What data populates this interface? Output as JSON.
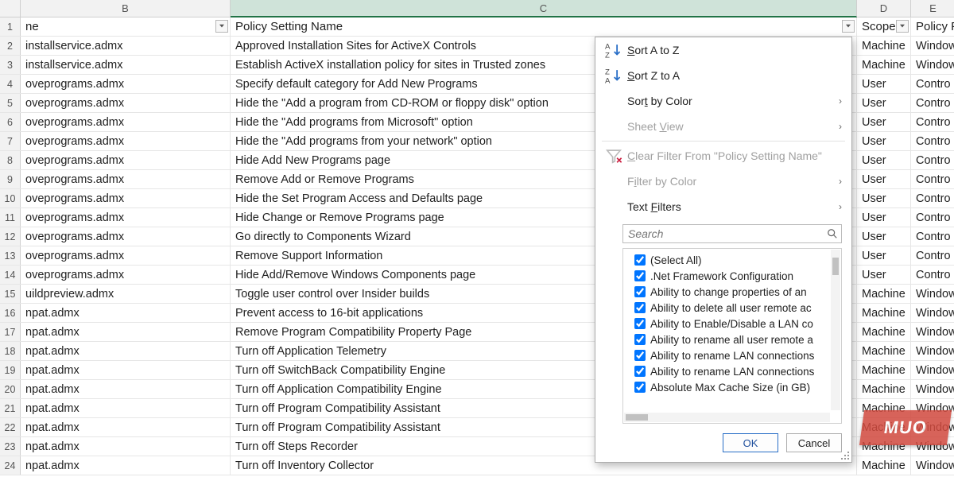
{
  "columns": {
    "B_letter": "B",
    "C_letter": "C",
    "D_letter": "D",
    "E_letter": "E",
    "B_header": "ne",
    "C_header": "Policy Setting Name",
    "D_header": "Scope",
    "E_header": "Policy F"
  },
  "rows": [
    {
      "n": "1"
    },
    {
      "n": "2",
      "b": "installservice.admx",
      "c": "Approved Installation Sites for ActiveX Controls",
      "d": "Machine",
      "e": "Window"
    },
    {
      "n": "3",
      "b": "installservice.admx",
      "c": "Establish ActiveX installation policy for sites in Trusted zones",
      "d": "Machine",
      "e": "Window"
    },
    {
      "n": "4",
      "b": "oveprograms.admx",
      "c": "Specify default category for Add New Programs",
      "d": "User",
      "e": "Contro"
    },
    {
      "n": "5",
      "b": "oveprograms.admx",
      "c": "Hide the \"Add a program from CD-ROM or floppy disk\" option",
      "d": "User",
      "e": "Contro"
    },
    {
      "n": "6",
      "b": "oveprograms.admx",
      "c": "Hide the \"Add programs from Microsoft\" option",
      "d": "User",
      "e": "Contro"
    },
    {
      "n": "7",
      "b": "oveprograms.admx",
      "c": "Hide the \"Add programs from your network\" option",
      "d": "User",
      "e": "Contro"
    },
    {
      "n": "8",
      "b": "oveprograms.admx",
      "c": "Hide Add New Programs page",
      "d": "User",
      "e": "Contro"
    },
    {
      "n": "9",
      "b": "oveprograms.admx",
      "c": "Remove Add or Remove Programs",
      "d": "User",
      "e": "Contro"
    },
    {
      "n": "10",
      "b": "oveprograms.admx",
      "c": "Hide the Set Program Access and Defaults page",
      "d": "User",
      "e": "Contro"
    },
    {
      "n": "11",
      "b": "oveprograms.admx",
      "c": "Hide Change or Remove Programs page",
      "d": "User",
      "e": "Contro"
    },
    {
      "n": "12",
      "b": "oveprograms.admx",
      "c": "Go directly to Components Wizard",
      "d": "User",
      "e": "Contro"
    },
    {
      "n": "13",
      "b": "oveprograms.admx",
      "c": "Remove Support Information",
      "d": "User",
      "e": "Contro"
    },
    {
      "n": "14",
      "b": "oveprograms.admx",
      "c": "Hide Add/Remove Windows Components page",
      "d": "User",
      "e": "Contro"
    },
    {
      "n": "15",
      "b": "uildpreview.admx",
      "c": "Toggle user control over Insider builds",
      "d": "Machine",
      "e": "Window"
    },
    {
      "n": "16",
      "b": "npat.admx",
      "c": "Prevent access to 16-bit applications",
      "d": "Machine",
      "e": "Window"
    },
    {
      "n": "17",
      "b": "npat.admx",
      "c": "Remove Program Compatibility Property Page",
      "d": "Machine",
      "e": "Window"
    },
    {
      "n": "18",
      "b": "npat.admx",
      "c": "Turn off Application Telemetry",
      "d": "Machine",
      "e": "Window"
    },
    {
      "n": "19",
      "b": "npat.admx",
      "c": "Turn off SwitchBack Compatibility Engine",
      "d": "Machine",
      "e": "Window"
    },
    {
      "n": "20",
      "b": "npat.admx",
      "c": "Turn off Application Compatibility Engine",
      "d": "Machine",
      "e": "Window"
    },
    {
      "n": "21",
      "b": "npat.admx",
      "c": "Turn off Program Compatibility Assistant",
      "d": "Machine",
      "e": "Window"
    },
    {
      "n": "22",
      "b": "npat.admx",
      "c": "Turn off Program Compatibility Assistant",
      "d": "Machine",
      "e": "Window"
    },
    {
      "n": "23",
      "b": "npat.admx",
      "c": "Turn off Steps Recorder",
      "d": "Machine",
      "e": "Window"
    },
    {
      "n": "24",
      "b": "npat.admx",
      "c": "Turn off Inventory Collector",
      "d": "Machine",
      "e": "Window"
    }
  ],
  "dropdown": {
    "sort_az_pre": "S",
    "sort_az_post": "ort A to Z",
    "sort_za_pre": "S",
    "sort_za_post": "ort Z to A",
    "sort_color_pre": "Sor",
    "sort_color_accel": "t",
    "sort_color_post": " by Color",
    "sheet_view_pre": "Sheet ",
    "sheet_view_accel": "V",
    "sheet_view_post": "iew",
    "clear_filter_accel": "C",
    "clear_filter_post": "lear Filter From \"Policy Setting Name\"",
    "filter_color_pre": "F",
    "filter_color_accel": "i",
    "filter_color_post": "lter by Color",
    "text_filters_pre": "Text ",
    "text_filters_accel": "F",
    "text_filters_post": "ilters",
    "search_placeholder": "Search",
    "checks": [
      "(Select All)",
      ".Net Framework Configuration",
      "Ability to change properties of an",
      "Ability to delete all user remote ac",
      "Ability to Enable/Disable a LAN co",
      "Ability to rename all user remote a",
      "Ability to rename LAN connections",
      "Ability to rename LAN connections",
      "Absolute Max Cache Size (in GB)"
    ],
    "ok": "OK",
    "cancel": "Cancel"
  },
  "watermark": "MUO"
}
